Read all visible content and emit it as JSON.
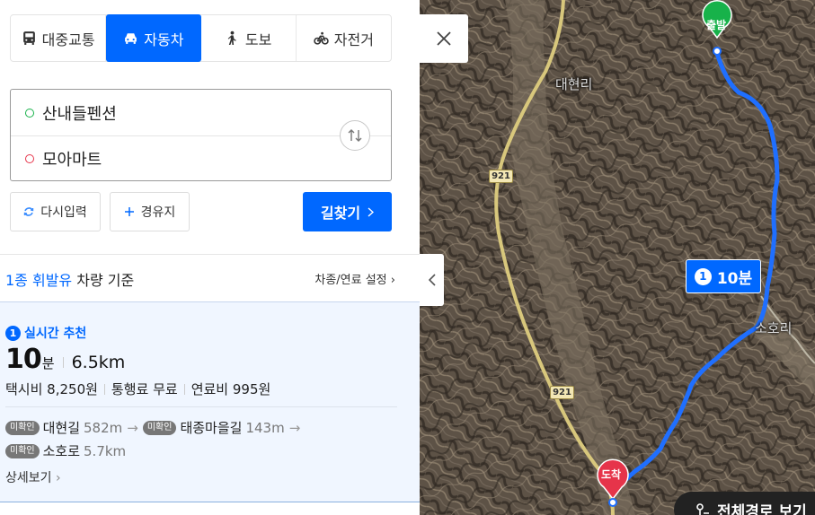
{
  "modes": [
    {
      "label": "대중교통",
      "icon": "bus-icon",
      "active": false
    },
    {
      "label": "자동차",
      "icon": "car-icon",
      "active": true
    },
    {
      "label": "도보",
      "icon": "walk-icon",
      "active": false
    },
    {
      "label": "자전거",
      "icon": "bike-icon",
      "active": false
    }
  ],
  "route": {
    "origin": "산내들펜션",
    "destination": "모아마트"
  },
  "buttons": {
    "reset": "다시입력",
    "via": "경유지",
    "search": "길찾기"
  },
  "basis": {
    "fuel": "1종 휘발유",
    "suffix": "차량 기준",
    "settings": "차종/연료 설정"
  },
  "result": {
    "rank": "1",
    "rank_label": "실시간 추천",
    "time_value": "10",
    "time_unit": "분",
    "distance": "6.5km",
    "taxi": "택시비 8,250원",
    "toll": "통행료 무료",
    "fuel_cost": "연료비 995원",
    "tag": "미확인",
    "roads": [
      {
        "name": "대현길",
        "length": "582m"
      },
      {
        "name": "태종마을길",
        "length": "143m"
      },
      {
        "name": "소호로",
        "length": "5.7km"
      }
    ],
    "detail": "상세보기"
  },
  "map": {
    "labels": {
      "village1": "대현리",
      "village2": "소호리"
    },
    "road_number": "921",
    "start_label": "출발",
    "end_label": "도착",
    "bubble_rank": "1",
    "bubble_time": "10분",
    "full_route": "전체경로 보기"
  },
  "colors": {
    "accent": "#0068ff",
    "start": "#17b24a",
    "end": "#e6344a",
    "route": "#1f6fff"
  }
}
